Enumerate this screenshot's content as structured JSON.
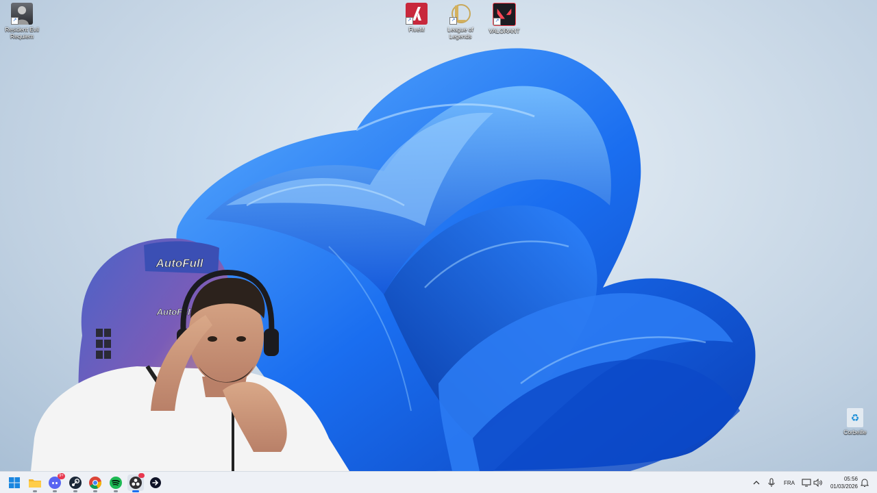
{
  "desktop": {
    "icons": [
      {
        "name": "Resident Evil Requiem",
        "color": "#3a3d44"
      },
      {
        "name": "FiveM",
        "color": "#c8283c"
      },
      {
        "name": "League of Legends",
        "color": "#0f2a38"
      },
      {
        "name": "VALORANT",
        "color": "#ff4655"
      },
      {
        "name": "Corbeille",
        "color": "#1d8fd8"
      }
    ],
    "wallpaper_accent": "#1a6ef0"
  },
  "webcam": {
    "chair_text": "AutoFull",
    "chair_text_2": "AutoFull"
  },
  "taskbar": {
    "apps": [
      {
        "name": "windows-start-icon"
      },
      {
        "name": "file-explorer-icon"
      },
      {
        "name": "discord-icon",
        "badge": "9+"
      },
      {
        "name": "steam-icon"
      },
      {
        "name": "chrome-icon"
      },
      {
        "name": "spotify-icon"
      },
      {
        "name": "obs-icon"
      },
      {
        "name": "arrow-app-icon"
      }
    ],
    "tray": {
      "language": "FRA",
      "time": "05:56",
      "date": "01/03/2026"
    }
  }
}
